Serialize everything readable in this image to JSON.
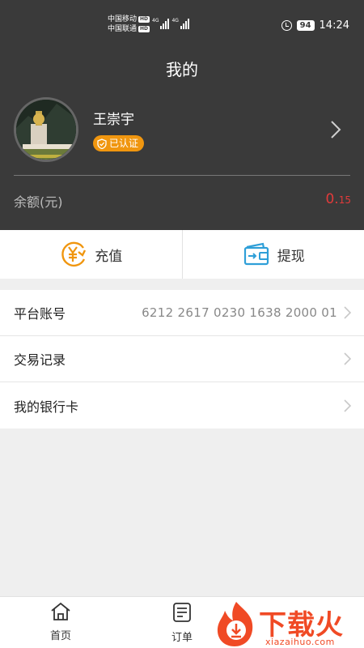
{
  "status_bar": {
    "carrier1": "中国移动",
    "carrier2": "中国联通",
    "hd": "HD",
    "net": "4G",
    "battery": "94",
    "time": "14:24"
  },
  "header": {
    "title": "我的"
  },
  "profile": {
    "name": "王崇宇",
    "verified_label": "已认证"
  },
  "balance": {
    "label": "余额(元)",
    "value_int": "0.",
    "value_dec": "15",
    "color": "#e23a3a"
  },
  "actions": {
    "recharge_label": "充值",
    "withdraw_label": "提现"
  },
  "menu": {
    "items": [
      {
        "label": "平台账号",
        "value": "6212 2617 0230 1638 2000 01"
      },
      {
        "label": "交易记录",
        "value": ""
      },
      {
        "label": "我的银行卡",
        "value": ""
      }
    ]
  },
  "bottom_nav": {
    "home_label": "首页",
    "orders_label": "订单"
  },
  "watermark": {
    "text": "下载火",
    "site": "xiazaihuo.com"
  },
  "colors": {
    "header_bg": "#3a3a3a",
    "accent_orange": "#f0960f",
    "accent_blue": "#2f9fd8",
    "watermark": "#f04a25"
  }
}
